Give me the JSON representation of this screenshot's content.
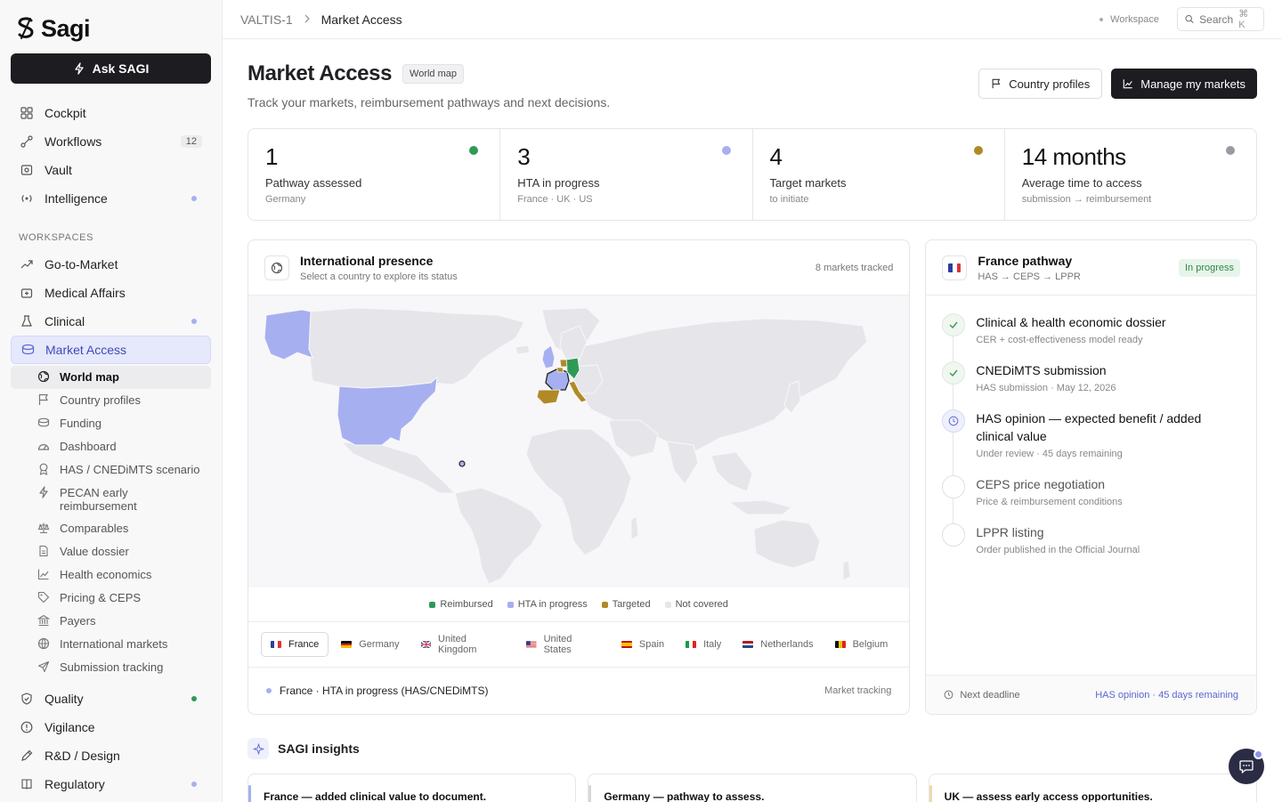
{
  "sidebar": {
    "brand": "Sagi",
    "ask_label": "Ask SAGI",
    "main_items": [
      {
        "label": "Cockpit"
      },
      {
        "label": "Workflows",
        "badge": "12"
      },
      {
        "label": "Vault"
      },
      {
        "label": "Intelligence"
      }
    ],
    "workspaces_label": "WORKSPACES",
    "workspaces": [
      {
        "label": "Go-to-Market"
      },
      {
        "label": "Medical Affairs"
      },
      {
        "label": "Clinical"
      },
      {
        "label": "Market Access"
      }
    ],
    "market_access_sub": [
      "World map",
      "Country profiles",
      "Funding",
      "Dashboard",
      "HAS / CNEDiMTS scenario",
      "PECAN early reimbursement",
      "Comparables",
      "Value dossier",
      "Health economics",
      "Pricing & CEPS",
      "Payers",
      "International markets",
      "Submission tracking"
    ],
    "bottom_items": [
      {
        "label": "Quality"
      },
      {
        "label": "Vigilance"
      },
      {
        "label": "R&D / Design"
      },
      {
        "label": "Regulatory"
      }
    ]
  },
  "topbar": {
    "crumb_root": "VALTIS-1",
    "crumb_current": "Market Access",
    "workspace_label": "Workspace",
    "search_label": "Search",
    "search_shortcut": "⌘ K"
  },
  "header": {
    "title": "Market Access",
    "view_pill": "World map",
    "subtitle": "Track your markets, reimbursement pathways and next decisions.",
    "btn_profiles": "Country profiles",
    "btn_manage": "Manage my markets"
  },
  "stats": [
    {
      "value": "1",
      "label": "Pathway assessed",
      "sub": "Germany",
      "color": "#2f9a55"
    },
    {
      "value": "3",
      "label": "HTA in progress",
      "sub": "France · UK · US",
      "color": "#a6b0f0"
    },
    {
      "value": "4",
      "label": "Target markets",
      "sub": "to initiate",
      "color": "#b08a26"
    },
    {
      "value": "14 months",
      "label": "Average time to access",
      "sub": "submission → reimbursement",
      "color": "#9a9aa2"
    }
  ],
  "map_card": {
    "title": "International presence",
    "subtitle": "Select a country to explore its status",
    "tracked": "8 markets tracked",
    "legend": [
      {
        "label": "Reimbursed",
        "color": "#2f9a55"
      },
      {
        "label": "HTA in progress",
        "color": "#a6b0f0"
      },
      {
        "label": "Targeted",
        "color": "#b08a26"
      },
      {
        "label": "Not covered",
        "color": "#e6e6ea"
      }
    ],
    "tabs": [
      "France",
      "Germany",
      "United Kingdom",
      "United States",
      "Spain",
      "Italy",
      "Netherlands",
      "Belgium"
    ],
    "selection": "France · HTA in progress (HAS/CNEDiMTS)",
    "selection_right": "Market tracking"
  },
  "france": {
    "title": "France pathway",
    "subtitle": "HAS → CEPS → LPPR",
    "status": "In progress",
    "steps": [
      {
        "title": "Clinical & health economic dossier",
        "desc": "CER + cost-effectiveness model ready",
        "state": "done"
      },
      {
        "title": "CNEDiMTS submission",
        "desc": "HAS submission · May 12, 2026",
        "state": "done"
      },
      {
        "title": "HAS opinion — expected benefit / added clinical value",
        "desc": "Under review · 45 days remaining",
        "state": "current"
      },
      {
        "title": "CEPS price negotiation",
        "desc": "Price & reimbursement conditions",
        "state": "todo"
      },
      {
        "title": "LPPR listing",
        "desc": "Order published in the Official Journal",
        "state": "todo"
      }
    ],
    "foot_label": "Next deadline",
    "foot_value": "HAS opinion · 45 days remaining"
  },
  "insights": {
    "title": "SAGI insights",
    "cards": [
      "France — added clinical value to document.",
      "Germany — pathway to assess.",
      "UK — assess early access opportunities."
    ]
  }
}
